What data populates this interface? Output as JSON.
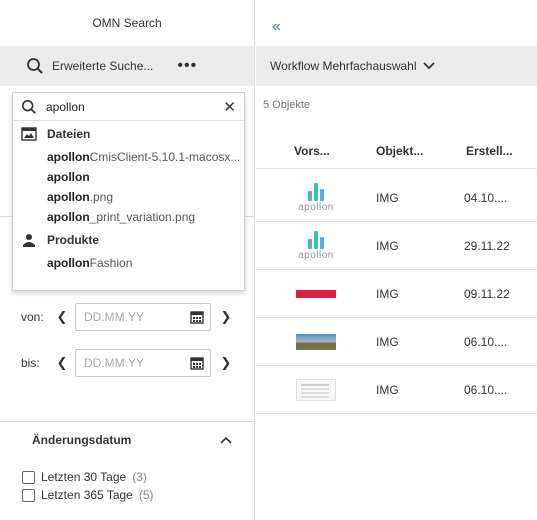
{
  "left": {
    "title": "OMN Search",
    "advanced_search_label": "Erweiterte Suche...",
    "more_label": "•••",
    "date_from_label": "von:",
    "date_to_label": "bis:",
    "date_placeholder": "DD.MM.YY",
    "change_date_section": "Änderungsdatum",
    "checkboxes": [
      {
        "label": "Letzten 30 Tage",
        "count": "(3)"
      },
      {
        "label": "Letzten 365 Tage",
        "count": "(5)"
      }
    ]
  },
  "search": {
    "query": "apollon",
    "groups": [
      {
        "label": "Dateien",
        "items": [
          {
            "bold": "apollon",
            "rest": "CmisClient-5.10.1-macosx..."
          },
          {
            "bold": "apollon",
            "rest": ""
          },
          {
            "bold": "apollon",
            "rest": ".png"
          },
          {
            "bold": "apollon",
            "rest": "_print_variation.png"
          }
        ]
      },
      {
        "label": "Produkte",
        "items": [
          {
            "bold": "apollon",
            "rest": " Fashion"
          }
        ]
      }
    ]
  },
  "right": {
    "workflow_label": "Workflow Mehrfachauswahl",
    "count_label": "5 Objekte",
    "columns": [
      "Vors...",
      "Objekt...",
      "Erstell..."
    ],
    "rows": [
      {
        "thumb": "apollon-logo",
        "type": "IMG",
        "date": "04.10...."
      },
      {
        "thumb": "apollon-logo",
        "type": "IMG",
        "date": "29.11.22"
      },
      {
        "thumb": "red-banner",
        "type": "IMG",
        "date": "09.11.22"
      },
      {
        "thumb": "landscape",
        "type": "IMG",
        "date": "06.10...."
      },
      {
        "thumb": "document",
        "type": "IMG",
        "date": "06.10...."
      }
    ],
    "logo_word": "apollon"
  },
  "colors": {
    "accent": "#3a7bd5",
    "toolbar_bg": "#ebebeb",
    "logo_blue": "#4ab3d6",
    "banner_red": "#d81f3c"
  }
}
